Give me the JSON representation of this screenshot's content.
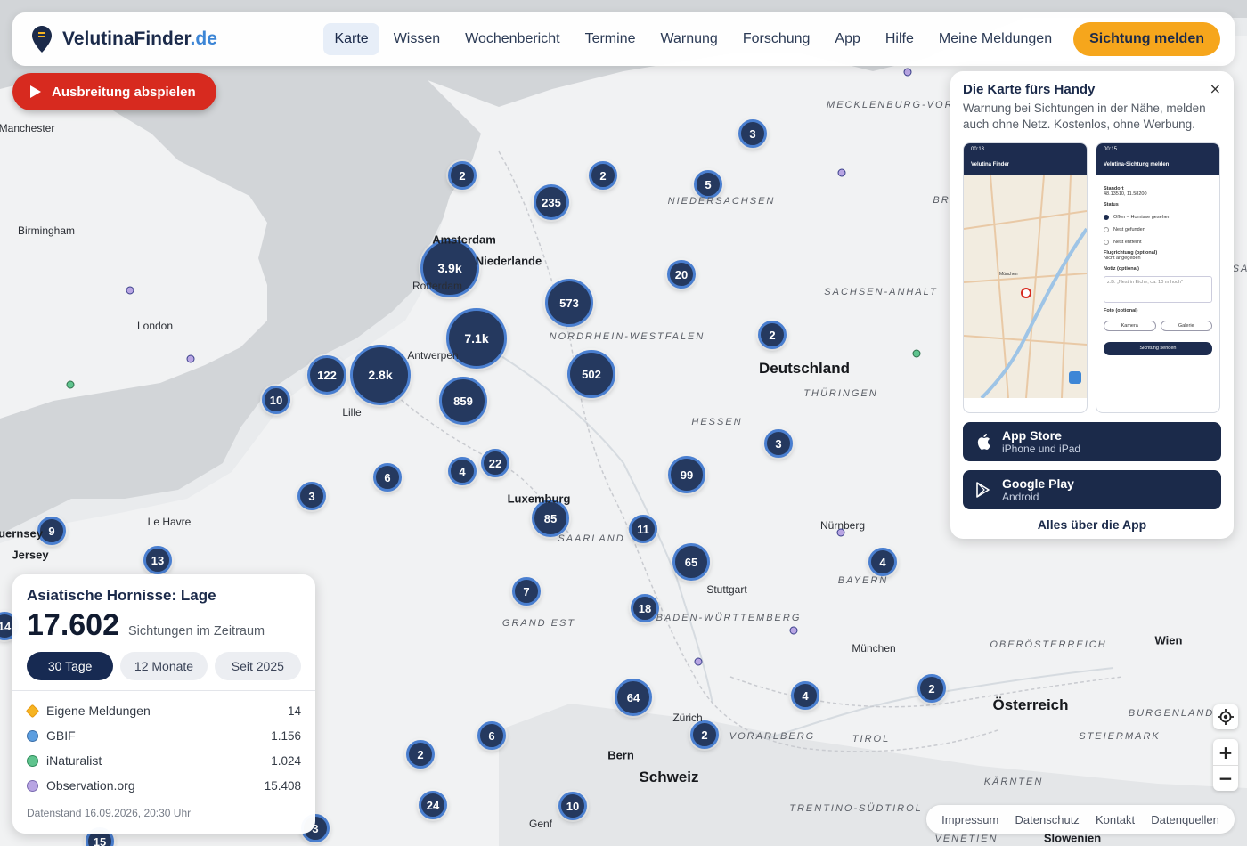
{
  "brand": {
    "name": "VelutinaFinder",
    "tld": ".de"
  },
  "nav": {
    "items": [
      {
        "label": "Karte",
        "active": true
      },
      {
        "label": "Wissen",
        "active": false
      },
      {
        "label": "Wochenbericht",
        "active": false
      },
      {
        "label": "Termine",
        "active": false
      },
      {
        "label": "Warnung",
        "active": false
      },
      {
        "label": "Forschung",
        "active": false
      },
      {
        "label": "App",
        "active": false
      },
      {
        "label": "Hilfe",
        "active": false
      },
      {
        "label": "Meine Meldungen",
        "active": false
      }
    ],
    "cta": "Sichtung melden"
  },
  "play_button": {
    "label": "Ausbreitung abspielen"
  },
  "app_card": {
    "title": "Die Karte fürs Handy",
    "text": "Warnung bei Sichtungen in der Nähe, melden auch ohne Netz. Kostenlos, ohne Werbung.",
    "close": "×",
    "phone1": {
      "time": "00:13",
      "app": "Velutina Finder",
      "location": "München"
    },
    "phone2": {
      "time": "00:15",
      "header": "Velutina-Sichtung melden",
      "standort": "Standort",
      "coords": "48.13510, 11.58200",
      "status": "Status",
      "options": [
        "Offen – Hornisse gesehen",
        "Nest gefunden",
        "Nest entfernt"
      ],
      "flug": "Flugrichtung (optional)",
      "flug_value": "Nicht angegeben",
      "notiz": "Notiz (optional)",
      "notiz_ph": "z.B. „Nest in Eiche, ca. 10 m hoch“",
      "foto": "Foto (optional)",
      "kamera": "Kamera",
      "galerie": "Galerie",
      "send": "Sichtung senden"
    },
    "appstore": {
      "title": "App Store",
      "sub": "iPhone und iPad"
    },
    "googleplay": {
      "title": "Google Play",
      "sub": "Android"
    },
    "link": "Alles über die App"
  },
  "stats": {
    "title": "Asiatische Hornisse: Lage",
    "count": "17.602",
    "count_label": "Sichtungen im Zeitraum",
    "tabs": [
      {
        "label": "30 Tage",
        "active": true
      },
      {
        "label": "12 Monate",
        "active": false
      },
      {
        "label": "Seit 2025",
        "active": false
      }
    ],
    "sources": [
      {
        "label": "Eigene Meldungen",
        "value": "14",
        "color": "#f6b422"
      },
      {
        "label": "GBIF",
        "value": "1.156",
        "color": "#5c9ee0"
      },
      {
        "label": "iNaturalist",
        "value": "1.024",
        "color": "#5fc48e"
      },
      {
        "label": "Observation.org",
        "value": "15.408",
        "color": "#b8a5e3"
      }
    ],
    "footer": "Datenstand 16.09.2026, 20:30 Uhr"
  },
  "footer_links": [
    "Impressum",
    "Datenschutz",
    "Kontakt",
    "Datenquellen"
  ],
  "map": {
    "clusters": [
      {
        "label": "3"
      },
      {
        "label": "2"
      },
      {
        "label": "2"
      },
      {
        "label": "5"
      },
      {
        "label": "235"
      },
      {
        "label": "3.9k"
      },
      {
        "label": "20"
      },
      {
        "label": "573"
      },
      {
        "label": "7.1k"
      },
      {
        "label": "2"
      },
      {
        "label": "122"
      },
      {
        "label": "2.8k"
      },
      {
        "label": "502"
      },
      {
        "label": "10"
      },
      {
        "label": "859"
      },
      {
        "label": "3"
      },
      {
        "label": "6"
      },
      {
        "label": "4"
      },
      {
        "label": "22"
      },
      {
        "label": "99"
      },
      {
        "label": "3"
      },
      {
        "label": "85"
      },
      {
        "label": "11"
      },
      {
        "label": "9"
      },
      {
        "label": "13"
      },
      {
        "label": "65"
      },
      {
        "label": "4"
      },
      {
        "label": "7"
      },
      {
        "label": "18"
      },
      {
        "label": "64"
      },
      {
        "label": "4"
      },
      {
        "label": "2"
      },
      {
        "label": "2"
      },
      {
        "label": "6"
      },
      {
        "label": "2"
      },
      {
        "label": "24"
      },
      {
        "label": "10"
      },
      {
        "label": "14"
      },
      {
        "label": "3"
      },
      {
        "label": "15"
      }
    ],
    "places": [
      {
        "label": "Manchester"
      },
      {
        "label": "Birmingham"
      },
      {
        "label": "London"
      },
      {
        "label": "Amsterdam"
      },
      {
        "label": "Niederlande"
      },
      {
        "label": "Rotterdam"
      },
      {
        "label": "Antwerpen"
      },
      {
        "label": "Lille"
      },
      {
        "label": "Le Havre"
      },
      {
        "label": "Luxemburg"
      },
      {
        "label": "SAARLAND"
      },
      {
        "label": "GRAND EST"
      },
      {
        "label": "NIEDERSACHSEN"
      },
      {
        "label": "NORDRHEIN-WESTFALEN"
      },
      {
        "label": "SACHSEN-ANHALT"
      },
      {
        "label": "Deutschland"
      },
      {
        "label": "THÜRINGEN"
      },
      {
        "label": "HESSEN"
      },
      {
        "label": "Nürnberg"
      },
      {
        "label": "BAYERN"
      },
      {
        "label": "Stuttgart"
      },
      {
        "label": "BADEN-WÜRTTEMBERG"
      },
      {
        "label": "München"
      },
      {
        "label": "Zürich"
      },
      {
        "label": "Bern"
      },
      {
        "label": "Schweiz"
      },
      {
        "label": "Genf"
      },
      {
        "label": "VORARLBERG"
      },
      {
        "label": "TIROL"
      },
      {
        "label": "Österreich"
      },
      {
        "label": "OBERÖSTERREICH"
      },
      {
        "label": "Wien"
      },
      {
        "label": "BURGENLAND"
      },
      {
        "label": "STEIERMARK"
      },
      {
        "label": "KÄRNTEN"
      },
      {
        "label": "TRENTINO-SÜDTIROL"
      },
      {
        "label": "Slowenien"
      },
      {
        "label": "VENETIEN"
      },
      {
        "label": "MECKLENBURG-VORPOMMERN"
      },
      {
        "label": "Guernsey"
      },
      {
        "label": "Jersey"
      },
      {
        "label": "BR"
      },
      {
        "label": "SA"
      }
    ]
  },
  "colors": {
    "brand_navy": "#1b2a4a",
    "accent_blue": "#3d86d6",
    "cta_orange": "#f6a61c",
    "play_red": "#d72a1f"
  }
}
